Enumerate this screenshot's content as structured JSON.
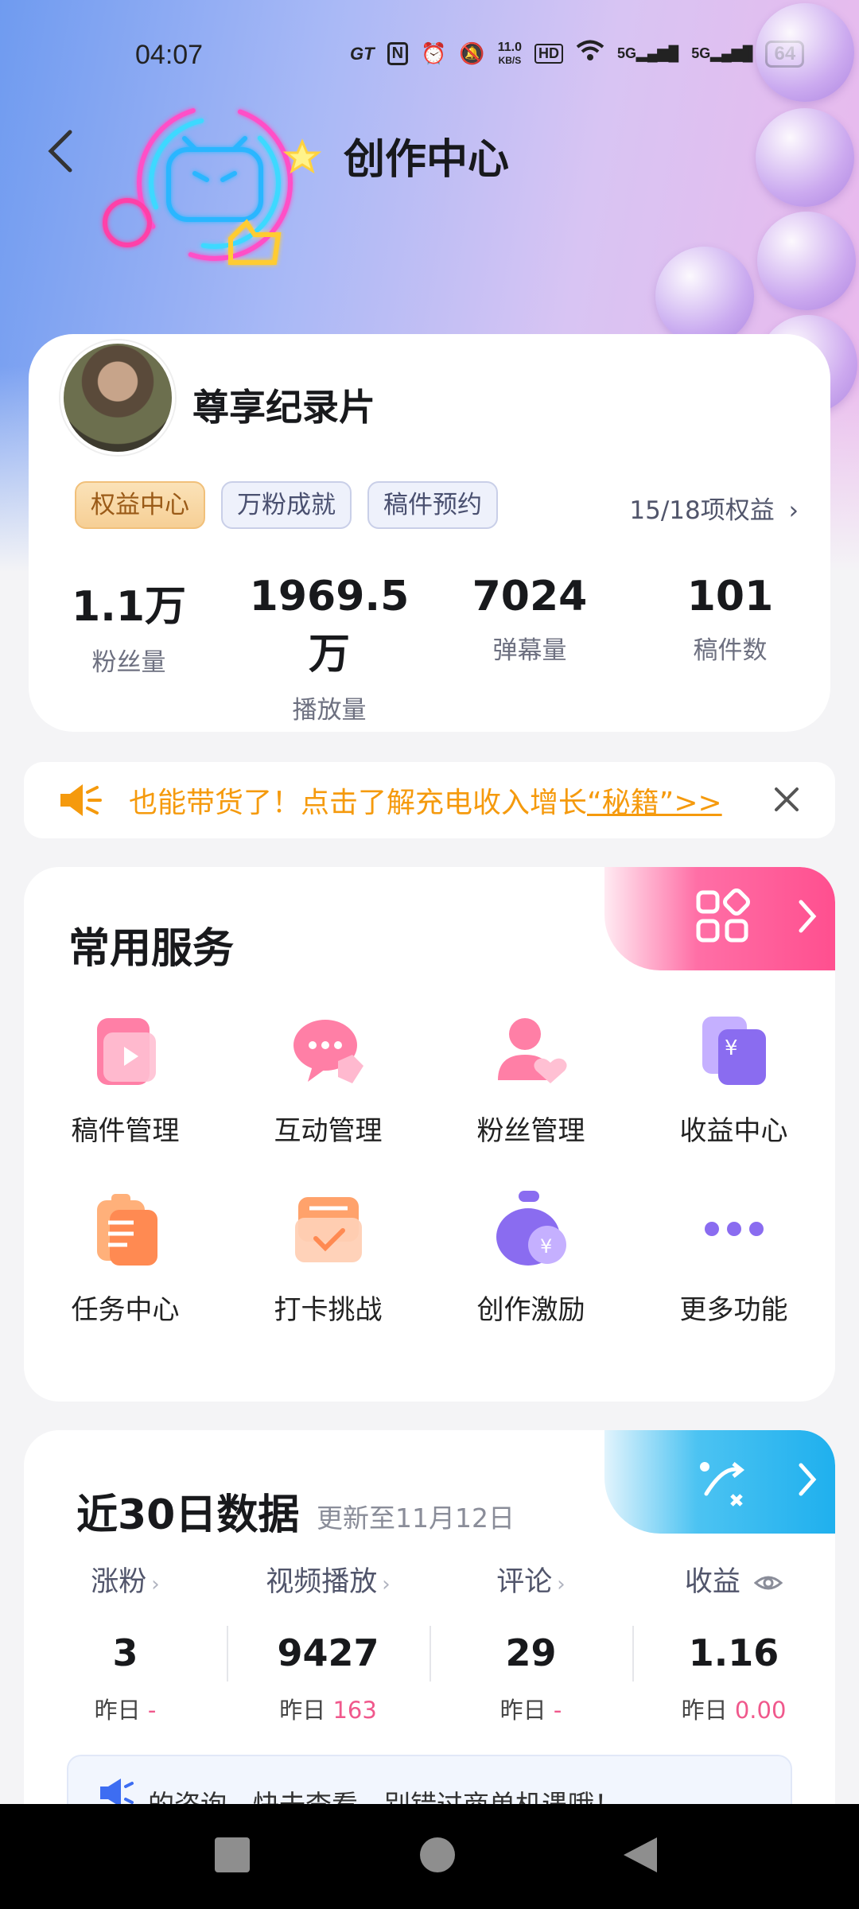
{
  "status_bar": {
    "time": "04:07",
    "network_speed": "11.0",
    "network_unit": "KB/S",
    "hd_label": "HD",
    "signal_1": "5G",
    "signal_2": "5G",
    "battery": "64"
  },
  "header": {
    "title": "创作中心"
  },
  "profile": {
    "username": "尊享纪录片",
    "tags": [
      "权益中心",
      "万粉成就",
      "稿件预约"
    ],
    "benefits_link": "15/18项权益",
    "stats": [
      {
        "value": "1.1万",
        "label": "粉丝量"
      },
      {
        "value": "1969.5万",
        "label": "播放量"
      },
      {
        "value": "7024",
        "label": "弹幕量"
      },
      {
        "value": "101",
        "label": "稿件数"
      }
    ]
  },
  "notice": {
    "text": "也能带货了！点击了解充电收入增长",
    "link_text": "“秘籍”>>"
  },
  "services": {
    "title": "常用服务",
    "items": [
      {
        "label": "稿件管理"
      },
      {
        "label": "互动管理"
      },
      {
        "label": "粉丝管理"
      },
      {
        "label": "收益中心"
      },
      {
        "label": "任务中心"
      },
      {
        "label": "打卡挑战"
      },
      {
        "label": "创作激励"
      },
      {
        "label": "更多功能"
      }
    ]
  },
  "data_panel": {
    "title": "近30日数据",
    "subtitle": "更新至11月12日",
    "yesterday_label": "昨日",
    "columns": [
      {
        "label": "涨粉",
        "value": "3",
        "yesterday": "-"
      },
      {
        "label": "视频播放",
        "value": "9427",
        "yesterday": "163"
      },
      {
        "label": "评论",
        "value": "29",
        "yesterday": "-"
      },
      {
        "label": "收益",
        "value": "1.16",
        "yesterday": "0.00"
      }
    ],
    "tip": "的咨询，快去查看，别错过商单机遇哦！"
  },
  "colors": {
    "accent_pink": "#f0588c",
    "notice_orange": "#f59a0d",
    "ribbon_pink": "#ff5f9a",
    "ribbon_blue": "#22b2ef"
  }
}
